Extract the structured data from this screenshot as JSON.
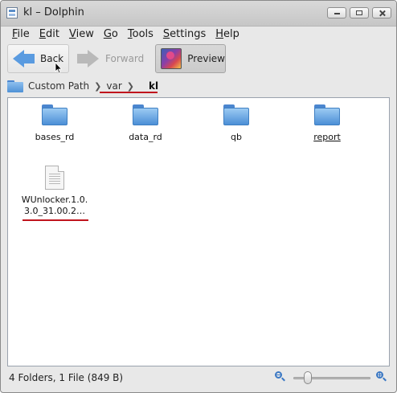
{
  "window": {
    "title": "kl – Dolphin"
  },
  "menu": [
    {
      "label": "File"
    },
    {
      "label": "Edit"
    },
    {
      "label": "View"
    },
    {
      "label": "Go"
    },
    {
      "label": "Tools"
    },
    {
      "label": "Settings"
    },
    {
      "label": "Help"
    }
  ],
  "toolbar": {
    "back": "Back",
    "forward": "Forward",
    "preview": "Preview",
    "preview_active": true,
    "forward_enabled": false
  },
  "breadcrumb": {
    "root": "Custom Path",
    "items": [
      "var",
      "kl"
    ]
  },
  "files": [
    {
      "name": "bases_rd",
      "type": "folder"
    },
    {
      "name": "data_rd",
      "type": "folder"
    },
    {
      "name": "qb",
      "type": "folder"
    },
    {
      "name": "report",
      "type": "folder"
    },
    {
      "name": "WUnlocker.1.0.3.0_31.00.2…",
      "line1": "WUnlocker.1.0.",
      "line2": "3.0_31.00.2…",
      "type": "file"
    }
  ],
  "status": {
    "text": "4 Folders, 1 File (849 B)",
    "zoom_level": 0.15
  },
  "colors": {
    "annotation": "#c0151d",
    "folder": "#4f91d6",
    "accent": "#5a9be0"
  }
}
